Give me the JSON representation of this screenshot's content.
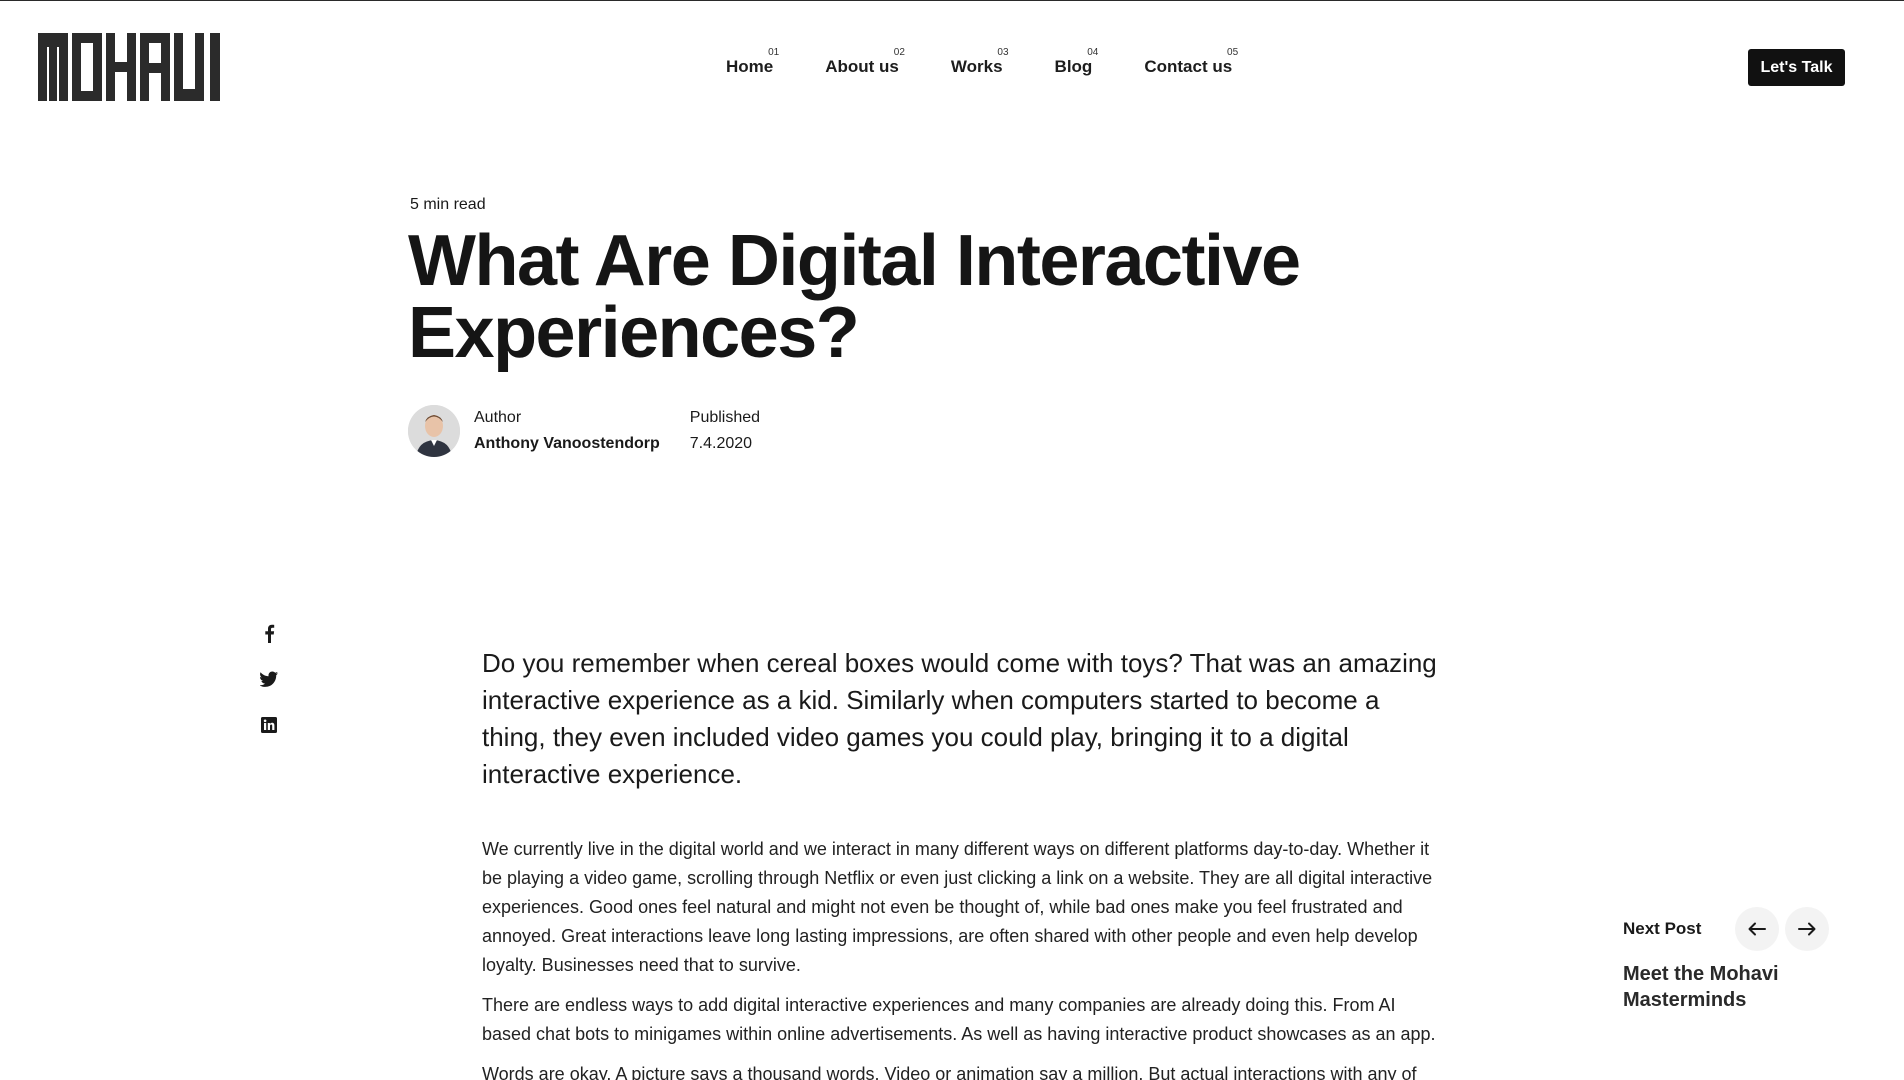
{
  "brand": {
    "logo_text": "MOHAVI"
  },
  "nav": {
    "items": [
      {
        "label": "Home",
        "num": "01"
      },
      {
        "label": "About us",
        "num": "02"
      },
      {
        "label": "Works",
        "num": "03"
      },
      {
        "label": "Blog",
        "num": "04"
      },
      {
        "label": "Contact us",
        "num": "05"
      }
    ],
    "cta_label": "Let's Talk"
  },
  "article": {
    "read_time": "5 min read",
    "title_line1": "What Are Digital Interactive",
    "title_line2": "Experiences?",
    "author_label": "Author",
    "author_name": "Anthony Vanoostendorp",
    "published_label": "Published",
    "published_date": "7.4.2020",
    "lead": "Do you remember when cereal boxes would come with toys? That was an amazing interactive experience as a kid. Similarly when computers started to become a thing, they even included video games you could play, bringing it to a digital interactive experience.",
    "paragraphs": [
      "We currently live in the digital world and we interact in many different ways on different platforms day-to-day. Whether it be playing a video game, scrolling through Netflix or even just clicking a link on a website. They are all digital interactive experiences. Good ones feel natural and might not even be thought of, while bad ones make you feel frustrated and annoyed. Great interactions leave long lasting impressions, are often shared with other people and even help develop loyalty. Businesses need that to survive.",
      "There are endless ways to add digital interactive experiences and many companies are already doing this. From AI based chat bots to minigames within online advertisements. As well as having interactive product showcases as an app.",
      "Words are okay. A picture says a thousand words. Video or animation say a million. But actual interactions with any of"
    ]
  },
  "share": {
    "icons": [
      "facebook-icon",
      "twitter-icon",
      "linkedin-icon"
    ]
  },
  "next_post": {
    "label": "Next Post",
    "title": "Meet the Mohavi Masterminds"
  },
  "colors": {
    "text": "#1a1a1a",
    "cta_bg": "#111111",
    "arrow_bg": "#f3f3f3"
  }
}
